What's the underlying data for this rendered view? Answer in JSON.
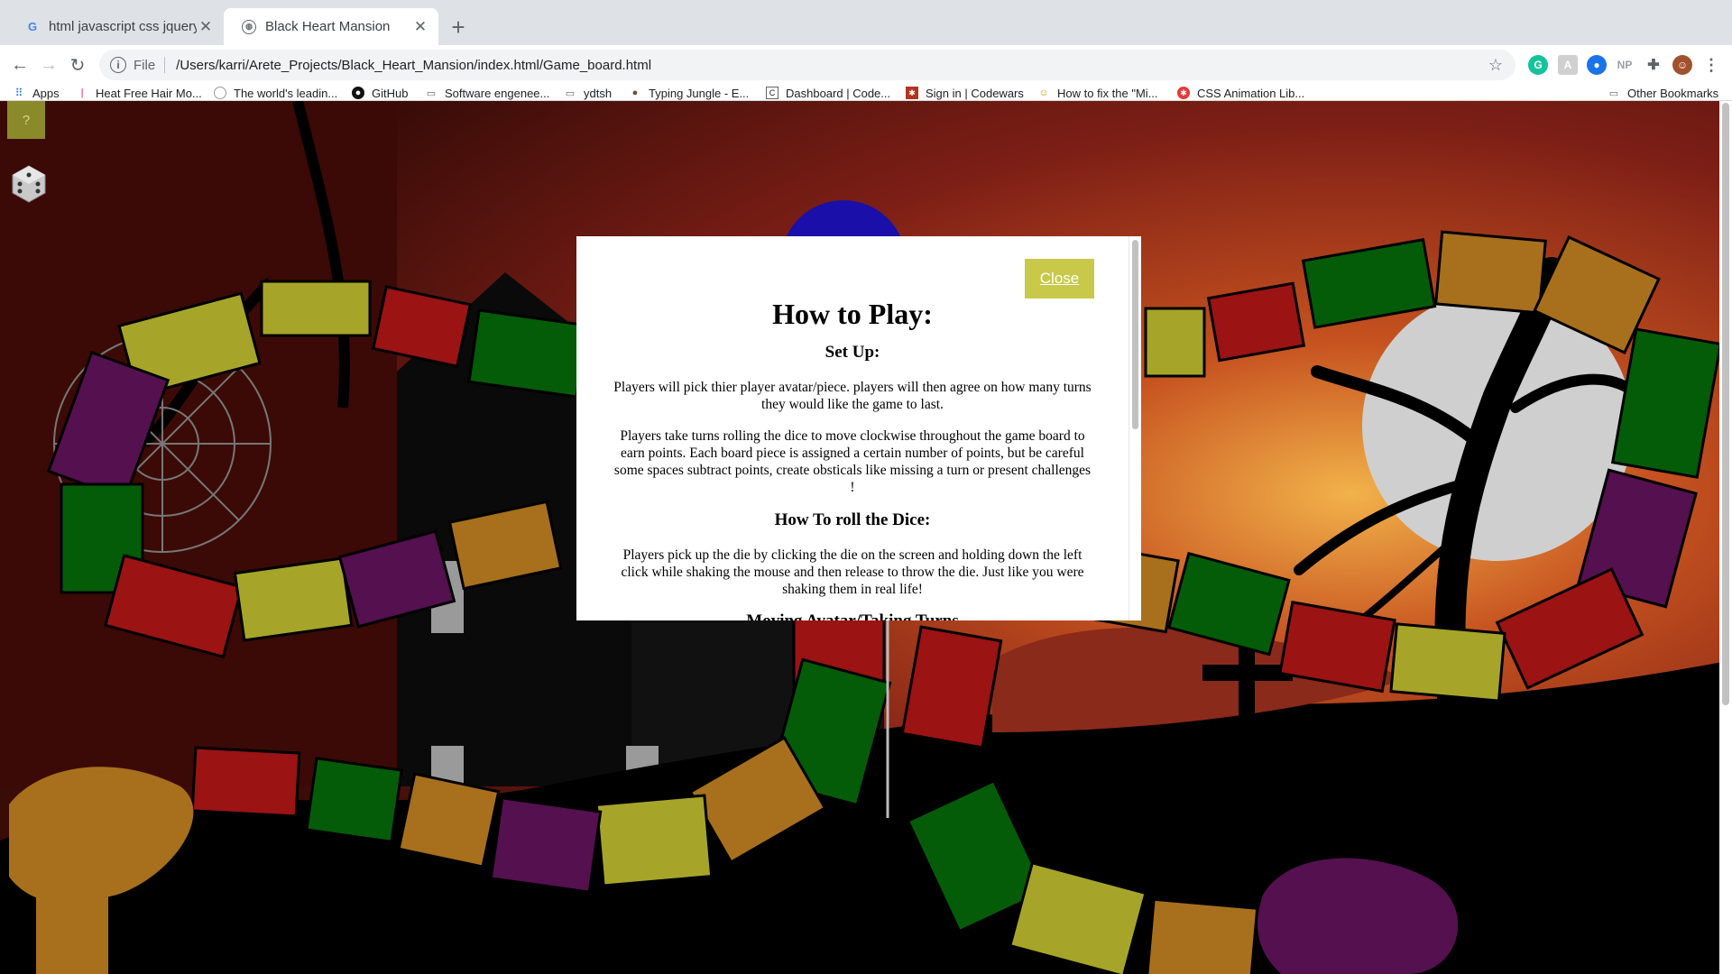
{
  "browser": {
    "tabs": [
      {
        "title": "html javascript css jquery gam",
        "active": false
      },
      {
        "title": "Black Heart Mansion",
        "active": true
      }
    ],
    "omnibox": {
      "scheme": "File",
      "url": "/Users/karri/Arete_Projects/Black_Heart_Mansion/index.html/Game_board.html"
    },
    "extensions": [
      "grammarly-icon",
      "extension-icon",
      "blue-extension-icon",
      "np-icon",
      "puzzle-icon",
      "profile-avatar",
      "menu-icon"
    ],
    "np_label": "NP",
    "bookmarks": [
      {
        "label": "Apps",
        "icon": "apps-grid-icon"
      },
      {
        "label": "Heat Free Hair Mo...",
        "icon": "bookmark-favicon"
      },
      {
        "label": "The world's leadin...",
        "icon": "github-favicon"
      },
      {
        "label": "GitHub",
        "icon": "github-favicon"
      },
      {
        "label": "Software engenee...",
        "icon": "folder-icon"
      },
      {
        "label": "ydtsh",
        "icon": "folder-icon"
      },
      {
        "label": "Typing Jungle - E...",
        "icon": "typing-jungle-favicon"
      },
      {
        "label": "Dashboard | Code...",
        "icon": "code-favicon"
      },
      {
        "label": "Sign in | Codewars",
        "icon": "codewars-favicon"
      },
      {
        "label": "How to fix the \"Mi...",
        "icon": "howto-favicon"
      },
      {
        "label": "CSS Animation Lib...",
        "icon": "css-favicon"
      }
    ],
    "other_bookmarks": "Other Bookmarks"
  },
  "game": {
    "help_label": "?",
    "board_colors": {
      "red": "#9b1313",
      "yellow": "#a6a52a",
      "green": "#045c08",
      "orange": "#a8701c",
      "purple": "#54104f"
    },
    "background_sky": "#8a2a18",
    "moon_color": "#d8d8d8"
  },
  "modal": {
    "close_label": "Close",
    "title": "How to Play:",
    "sections": [
      {
        "heading": "Set Up:",
        "paragraphs": [
          "Players will pick thier player avatar/piece. players will then agree on how many turns they would like the game to last.",
          "Players take turns rolling the dice to move clockwise throughout the game board to earn points. Each board piece is assigned a certain number of points, but be careful some spaces subtract points, create obsticals like missing a turn or present challenges !"
        ]
      },
      {
        "heading": "How To roll the Dice:",
        "paragraphs": [
          "Players pick up the die by clicking the die on the screen and holding down the left click while shaking the mouse and then release to throw the die. Just like you were shaking them in real life!"
        ]
      },
      {
        "heading": "Moving Avatar/Taking Turns",
        "paragraphs": []
      }
    ]
  }
}
